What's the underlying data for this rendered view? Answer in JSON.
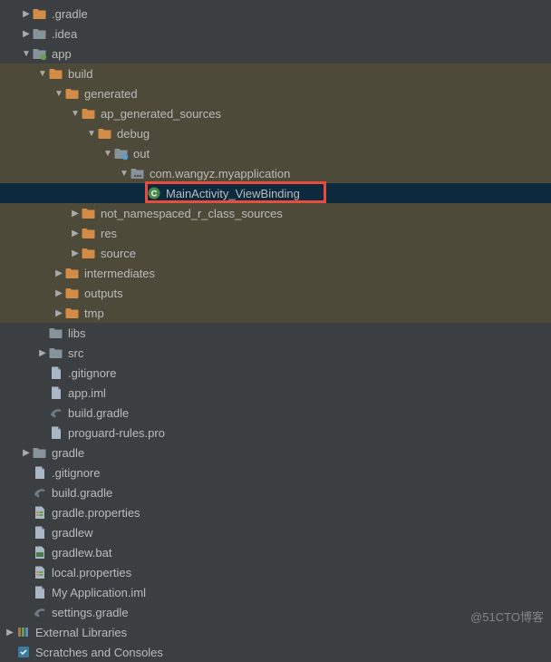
{
  "tree": [
    {
      "indent": 0,
      "arrow": "right",
      "icon": "folder-orange",
      "label": ".gradle",
      "row_class": ""
    },
    {
      "indent": 0,
      "arrow": "right",
      "icon": "folder-gray",
      "label": ".idea",
      "row_class": ""
    },
    {
      "indent": 0,
      "arrow": "down",
      "icon": "folder-module",
      "label": "app",
      "row_class": ""
    },
    {
      "indent": 1,
      "arrow": "down",
      "icon": "folder-orange",
      "label": "build",
      "row_class": "highlighted-olive"
    },
    {
      "indent": 2,
      "arrow": "down",
      "icon": "folder-orange",
      "label": "generated",
      "row_class": "highlighted-olive"
    },
    {
      "indent": 3,
      "arrow": "down",
      "icon": "folder-orange",
      "label": "ap_generated_sources",
      "row_class": "highlighted-olive"
    },
    {
      "indent": 4,
      "arrow": "down",
      "icon": "folder-orange",
      "label": "debug",
      "row_class": "highlighted-olive"
    },
    {
      "indent": 5,
      "arrow": "down",
      "icon": "folder-source",
      "label": "out",
      "row_class": "highlighted-olive"
    },
    {
      "indent": 6,
      "arrow": "down",
      "icon": "package",
      "label": "com.wangyz.myapplication",
      "row_class": "highlighted-olive"
    },
    {
      "indent": 7,
      "arrow": "none",
      "icon": "class",
      "label": "MainActivity_ViewBinding",
      "row_class": "selected",
      "boxed": true
    },
    {
      "indent": 3,
      "arrow": "right",
      "icon": "folder-orange",
      "label": "not_namespaced_r_class_sources",
      "row_class": "highlighted-olive"
    },
    {
      "indent": 3,
      "arrow": "right",
      "icon": "folder-orange",
      "label": "res",
      "row_class": "highlighted-olive"
    },
    {
      "indent": 3,
      "arrow": "right",
      "icon": "folder-orange",
      "label": "source",
      "row_class": "highlighted-olive"
    },
    {
      "indent": 2,
      "arrow": "right",
      "icon": "folder-orange",
      "label": "intermediates",
      "row_class": "highlighted-olive"
    },
    {
      "indent": 2,
      "arrow": "right",
      "icon": "folder-orange",
      "label": "outputs",
      "row_class": "highlighted-olive"
    },
    {
      "indent": 2,
      "arrow": "right",
      "icon": "folder-orange",
      "label": "tmp",
      "row_class": "highlighted-olive"
    },
    {
      "indent": 1,
      "arrow": "none",
      "icon": "folder-gray",
      "label": "libs",
      "row_class": ""
    },
    {
      "indent": 1,
      "arrow": "right",
      "icon": "folder-gray",
      "label": "src",
      "row_class": ""
    },
    {
      "indent": 1,
      "arrow": "none",
      "icon": "file",
      "label": ".gitignore",
      "row_class": ""
    },
    {
      "indent": 1,
      "arrow": "none",
      "icon": "file",
      "label": "app.iml",
      "row_class": ""
    },
    {
      "indent": 1,
      "arrow": "none",
      "icon": "gradle",
      "label": "build.gradle",
      "row_class": ""
    },
    {
      "indent": 1,
      "arrow": "none",
      "icon": "file",
      "label": "proguard-rules.pro",
      "row_class": ""
    },
    {
      "indent": 0,
      "arrow": "right",
      "icon": "folder-gray",
      "label": "gradle",
      "row_class": ""
    },
    {
      "indent": 0,
      "arrow": "none",
      "icon": "file",
      "label": ".gitignore",
      "row_class": ""
    },
    {
      "indent": 0,
      "arrow": "none",
      "icon": "gradle",
      "label": "build.gradle",
      "row_class": ""
    },
    {
      "indent": 0,
      "arrow": "none",
      "icon": "properties",
      "label": "gradle.properties",
      "row_class": ""
    },
    {
      "indent": 0,
      "arrow": "none",
      "icon": "file",
      "label": "gradlew",
      "row_class": ""
    },
    {
      "indent": 0,
      "arrow": "none",
      "icon": "file-bat",
      "label": "gradlew.bat",
      "row_class": ""
    },
    {
      "indent": 0,
      "arrow": "none",
      "icon": "properties",
      "label": "local.properties",
      "row_class": ""
    },
    {
      "indent": 0,
      "arrow": "none",
      "icon": "file",
      "label": "My Application.iml",
      "row_class": ""
    },
    {
      "indent": 0,
      "arrow": "none",
      "icon": "gradle",
      "label": "settings.gradle",
      "row_class": ""
    }
  ],
  "footer": [
    {
      "indent": -1,
      "arrow": "right",
      "icon": "libraries",
      "label": "External Libraries"
    },
    {
      "indent": -1,
      "arrow": "none",
      "icon": "scratches",
      "label": "Scratches and Consoles"
    }
  ],
  "colors": {
    "folder_orange": "#d28c47",
    "folder_gray": "#87939a",
    "folder_module": "#87939a",
    "class_circle": "#4a8a4a",
    "source_blue": "#5b9bd5",
    "package_gray": "#87939a",
    "selected_bg": "#0d293e",
    "highlight_bg": "#4e4a3a"
  },
  "watermark": "@51CTO博客",
  "indent_base": 22,
  "indent_step": 18
}
